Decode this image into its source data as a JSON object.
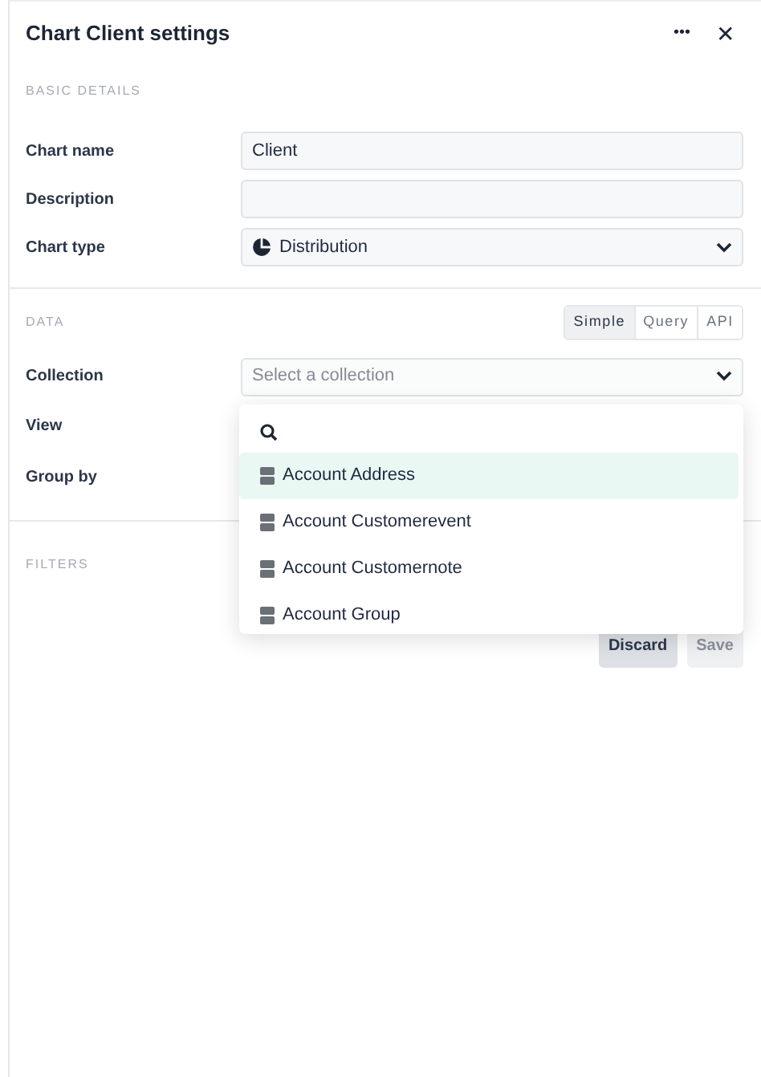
{
  "header": {
    "title": "Chart Client settings",
    "more": "•••",
    "close": "✕"
  },
  "basic": {
    "heading": "BASIC DETAILS",
    "fields": [
      {
        "kind": "input",
        "label": "Chart name",
        "value": "Client"
      },
      {
        "kind": "input",
        "label": "Description"
      },
      {
        "kind": "select",
        "label": "Chart type",
        "value": "Distribution"
      }
    ]
  },
  "data": {
    "heading": "DATA",
    "modes": [
      {
        "label": "Simple",
        "selected": true
      },
      {
        "label": "Query",
        "selected": false
      },
      {
        "label": "API",
        "selected": false
      }
    ],
    "fields": [
      {
        "kind": "select",
        "label": "Collection",
        "placeholder": "Select a collection"
      },
      {
        "kind": "label",
        "label": "View"
      },
      {
        "kind": "label",
        "label": "Group by"
      }
    ]
  },
  "filters": {
    "heading": "FILTERS"
  },
  "buttons": [
    {
      "label": "Discard",
      "disabled": false
    },
    {
      "label": "Save",
      "disabled": true
    }
  ],
  "dropdown": {
    "items": [
      {
        "label": "Account Address",
        "selected": true
      },
      {
        "label": "Account Customerevent",
        "selected": false
      },
      {
        "label": "Account Customernote",
        "selected": false
      },
      {
        "label": "Account Group",
        "selected": false
      }
    ]
  }
}
